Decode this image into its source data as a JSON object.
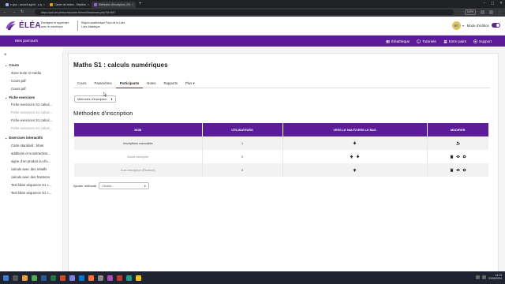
{
  "browser": {
    "tabs": [
      {
        "label": "e-lyco : accueil agent - e-lyco",
        "active": false
      },
      {
        "label": "Cahier de textes - Etablisseme",
        "active": false
      },
      {
        "label": "Méthodes d'inscription | Élé",
        "active": true
      }
    ],
    "new_tab": "+",
    "url": "https://pdl-ari-prima.eduzone.fr/enrol/instances.php?id=697",
    "zoom": "110%"
  },
  "header": {
    "logo_text": "ÉLÉA",
    "tagline_1": "Enseigner et apprendre",
    "tagline_2": "avec le numérique",
    "region_1": "Région académique Pays de la Loire",
    "region_2": "Loire-Atlantique",
    "user_initials": "BT",
    "edit_mode_label": "Mode d'édition"
  },
  "purple_nav": {
    "left": "Mes parcours",
    "items": [
      "Éléathèque",
      "Tutoriels",
      "Entre pairs",
      "Support"
    ]
  },
  "sidebar": {
    "sections": [
      {
        "title": "Cours",
        "items": [
          "Zone texte et média",
          "Cours pdf",
          "Cours pdf"
        ]
      },
      {
        "title": "Fiche exercices",
        "items": [
          "Fiche exercices S1 calcul...",
          "Fiche exercices S1 calcul...",
          "Fiche exercices S1 calcul...",
          "Fiche exercices S1 calcul..."
        ]
      },
      {
        "title": "Exercices interactifs",
        "items": [
          "Carte standard : khan",
          "additions et soustraction...",
          "signe d'un produit ou d'u...",
          "calculs avec des relatifs",
          "calculs avec des fractions",
          "Test bilan séquence S1 c...",
          "Test bilan séquence S1 c..."
        ]
      }
    ]
  },
  "page": {
    "title": "Maths S1 : calculs numériques",
    "tabs": [
      "Cours",
      "Paramètres",
      "Participants",
      "Notes",
      "Rapports",
      "Plus"
    ],
    "active_tab": "Participants",
    "tab_more_caret": "▾",
    "selector_label": "Méthodes d'inscription",
    "heading": "Méthodes d'inscription",
    "table": {
      "headers": [
        "NOM",
        "UTILISATEURS",
        "VERS LE HAUT/VERS LE BAS",
        "MODIFIER"
      ],
      "rows": [
        {
          "name": "Inscriptions manuelles",
          "users": "1"
        },
        {
          "name": "Accès anonyme",
          "users": "0"
        },
        {
          "name": "Auto-inscription (Étudiant)",
          "users": "0"
        }
      ]
    },
    "add_method_label": "Ajouter méthode",
    "add_method_value": "Choisir..."
  },
  "taskbar": {
    "time": "14:13",
    "date": "03/09/2024"
  },
  "colors": {
    "brand_purple": "#5c1c9a",
    "logo_purple": "#5b2a86"
  }
}
